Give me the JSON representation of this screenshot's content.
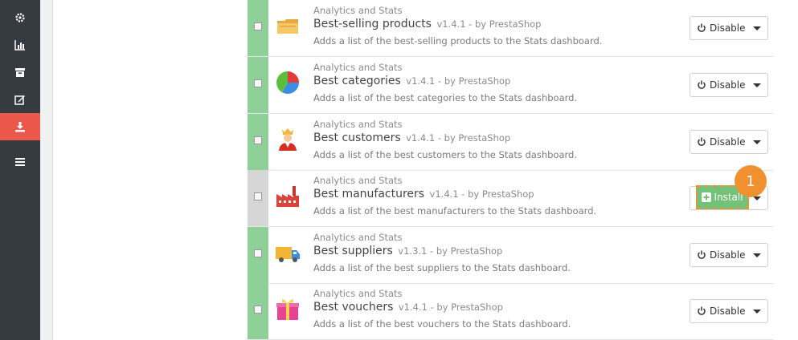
{
  "sidebar": {
    "items": [
      {
        "icon": "gear-icon"
      },
      {
        "icon": "bar-chart-icon"
      },
      {
        "icon": "archive-icon"
      },
      {
        "icon": "edit-icon"
      },
      {
        "icon": "download-icon",
        "active": true
      },
      {
        "icon": "list-icon"
      }
    ]
  },
  "colors": {
    "sidebar_bg": "#363a41",
    "sidebar_active": "#e9584a",
    "status_installed": "#8ed097",
    "status_uninstalled": "#d6d6d6",
    "install_green": "#72c279",
    "highlight_orange": "#f0902f"
  },
  "modules": [
    {
      "category": "Analytics and Stats",
      "name": "Best-selling products",
      "version": "v1.4.1 - by PrestaShop",
      "description": "Adds a list of the best-selling products to the Stats dashboard.",
      "icon": "folder-icon",
      "action": "Disable",
      "installed": true
    },
    {
      "category": "Analytics and Stats",
      "name": "Best categories",
      "version": "v1.4.1 - by PrestaShop",
      "description": "Adds a list of the best categories to the Stats dashboard.",
      "icon": "pie-chart-icon",
      "action": "Disable",
      "installed": true
    },
    {
      "category": "Analytics and Stats",
      "name": "Best customers",
      "version": "v1.4.1 - by PrestaShop",
      "description": "Adds a list of the best customers to the Stats dashboard.",
      "icon": "king-icon",
      "action": "Disable",
      "installed": true
    },
    {
      "category": "Analytics and Stats",
      "name": "Best manufacturers",
      "version": "v1.4.1 - by PrestaShop",
      "description": "Adds a list of the best manufacturers to the Stats dashboard.",
      "icon": "factory-icon",
      "action": "Install",
      "installed": false
    },
    {
      "category": "Analytics and Stats",
      "name": "Best suppliers",
      "version": "v1.3.1 - by PrestaShop",
      "description": "Adds a list of the best suppliers to the Stats dashboard.",
      "icon": "truck-icon",
      "action": "Disable",
      "installed": true
    },
    {
      "category": "Analytics and Stats",
      "name": "Best vouchers",
      "version": "v1.4.1 - by PrestaShop",
      "description": "Adds a list of the best vouchers to the Stats dashboard.",
      "icon": "gift-icon",
      "action": "Disable",
      "installed": true
    }
  ],
  "step_badge": "1"
}
